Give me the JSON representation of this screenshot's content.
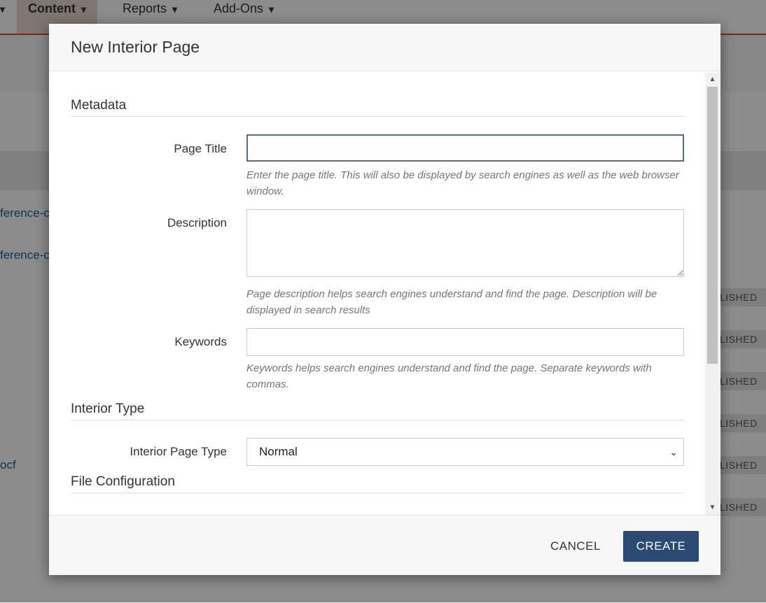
{
  "background": {
    "nav": [
      {
        "label": "Content"
      },
      {
        "label": "Reports"
      },
      {
        "label": "Add-Ons"
      }
    ],
    "links": [
      "ference-c",
      "ference-c",
      "ocf"
    ],
    "badge": "LISHED"
  },
  "modal": {
    "title": "New Interior Page",
    "sections": {
      "metadata": "Metadata",
      "interior_type": "Interior Type",
      "file_config": "File Configuration"
    },
    "fields": {
      "page_title": {
        "label": "Page Title",
        "value": "",
        "help": "Enter the page title. This will also be displayed by search engines as well as the web browser window."
      },
      "description": {
        "label": "Description",
        "value": "",
        "help": "Page description helps search engines understand and find the page. Description will be displayed in search results"
      },
      "keywords": {
        "label": "Keywords",
        "value": "",
        "help": "Keywords helps search engines understand and find the page. Separate keywords with commas."
      },
      "interior_page_type": {
        "label": "Interior Page Type",
        "selected": "Normal"
      }
    },
    "footer": {
      "cancel": "CANCEL",
      "create": "CREATE"
    }
  },
  "colors": {
    "primary_button": "#2b4a73",
    "nav_accent": "#c9541f"
  }
}
